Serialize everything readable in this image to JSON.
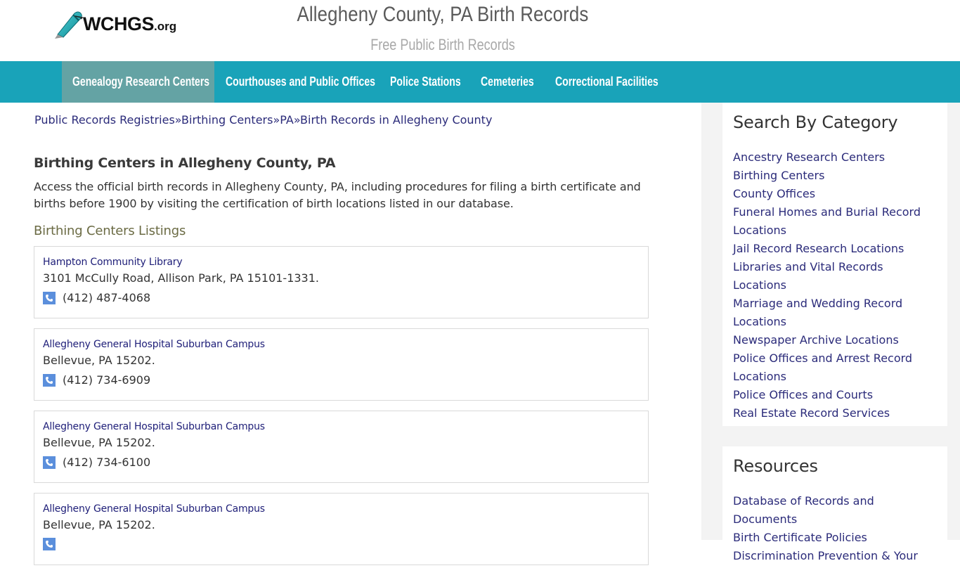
{
  "header": {
    "logo_text": "WCHGS",
    "logo_suffix": ".org",
    "title": "Allegheny County, PA Birth Records",
    "subtitle": "Free Public Birth Records"
  },
  "nav": {
    "items": [
      {
        "label": "Genealogy Research Centers",
        "active": true
      },
      {
        "label": "Courthouses and Public Offices",
        "active": false
      },
      {
        "label": "Police Stations",
        "active": false
      },
      {
        "label": "Cemeteries",
        "active": false
      },
      {
        "label": "Correctional Facilities",
        "active": false
      }
    ]
  },
  "breadcrumb": {
    "items": [
      "Public Records Registries",
      "Birthing Centers",
      "PA",
      "Birth Records in Allegheny County"
    ],
    "separator": "»"
  },
  "main": {
    "section_title": "Birthing Centers in Allegheny County, PA",
    "intro": "Access the official birth records in Allegheny County, PA, including procedures for filing a birth certificate and births before 1900 by visiting the certification of birth locations listed in our database.",
    "listings_title": "Birthing Centers Listings",
    "listings": [
      {
        "name": "Hampton Community Library",
        "address": "3101 McCully Road, Allison Park, PA 15101-1331.",
        "phone": "(412) 487-4068"
      },
      {
        "name": "Allegheny General Hospital Suburban Campus",
        "address": "Bellevue, PA 15202.",
        "phone": "(412) 734-6909"
      },
      {
        "name": "Allegheny General Hospital Suburban Campus",
        "address": "Bellevue, PA 15202.",
        "phone": "(412) 734-6100"
      },
      {
        "name": "Allegheny General Hospital Suburban Campus",
        "address": "Bellevue, PA 15202.",
        "phone": ""
      }
    ]
  },
  "sidebar": {
    "categories": {
      "title": "Search By Category",
      "links": [
        "Ancestry Research Centers",
        "Birthing Centers",
        "County Offices",
        "Funeral Homes and Burial Record Locations",
        "Jail Record Research Locations",
        "Libraries and Vital Records Locations",
        "Marriage and Wedding Record Locations",
        "Newspaper Archive Locations",
        "Police Offices and Arrest Record Locations",
        "Police Offices and Courts",
        "Real Estate Record Services"
      ]
    },
    "resources": {
      "title": "Resources",
      "links": [
        "Database of Records and Documents",
        "Birth Certificate Policies",
        "Discrimination Prevention & Your"
      ]
    }
  },
  "colors": {
    "nav_bg": "#19a3b9",
    "nav_active_bg": "#64a3a4",
    "link": "#2b2b7a",
    "phone_icon": "#5b8fdc",
    "sidebar_bg": "#f3f3f3"
  }
}
